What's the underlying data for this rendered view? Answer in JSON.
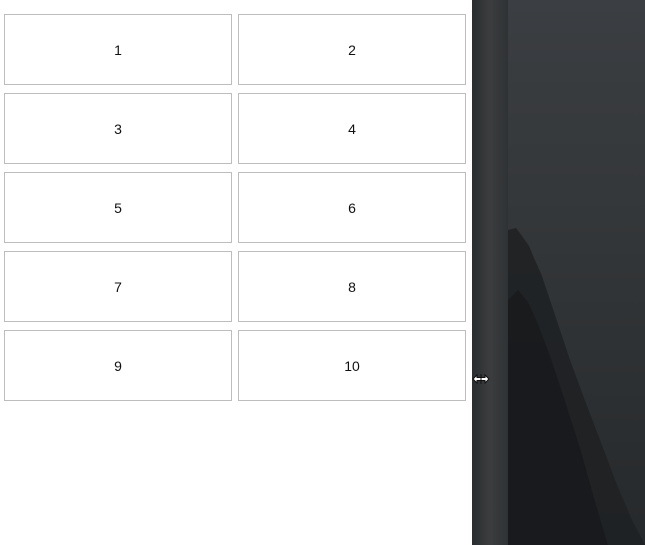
{
  "cards": [
    {
      "label": "1"
    },
    {
      "label": "2"
    },
    {
      "label": "3"
    },
    {
      "label": "4"
    },
    {
      "label": "5"
    },
    {
      "label": "6"
    },
    {
      "label": "7"
    },
    {
      "label": "8"
    },
    {
      "label": "9"
    },
    {
      "label": "10"
    }
  ],
  "colors": {
    "card_border": "#bdbdbd",
    "page_background": "#ffffff",
    "desktop_background": "#34373a"
  },
  "icons": {
    "cursor": "resize-horizontal-cursor-icon"
  }
}
